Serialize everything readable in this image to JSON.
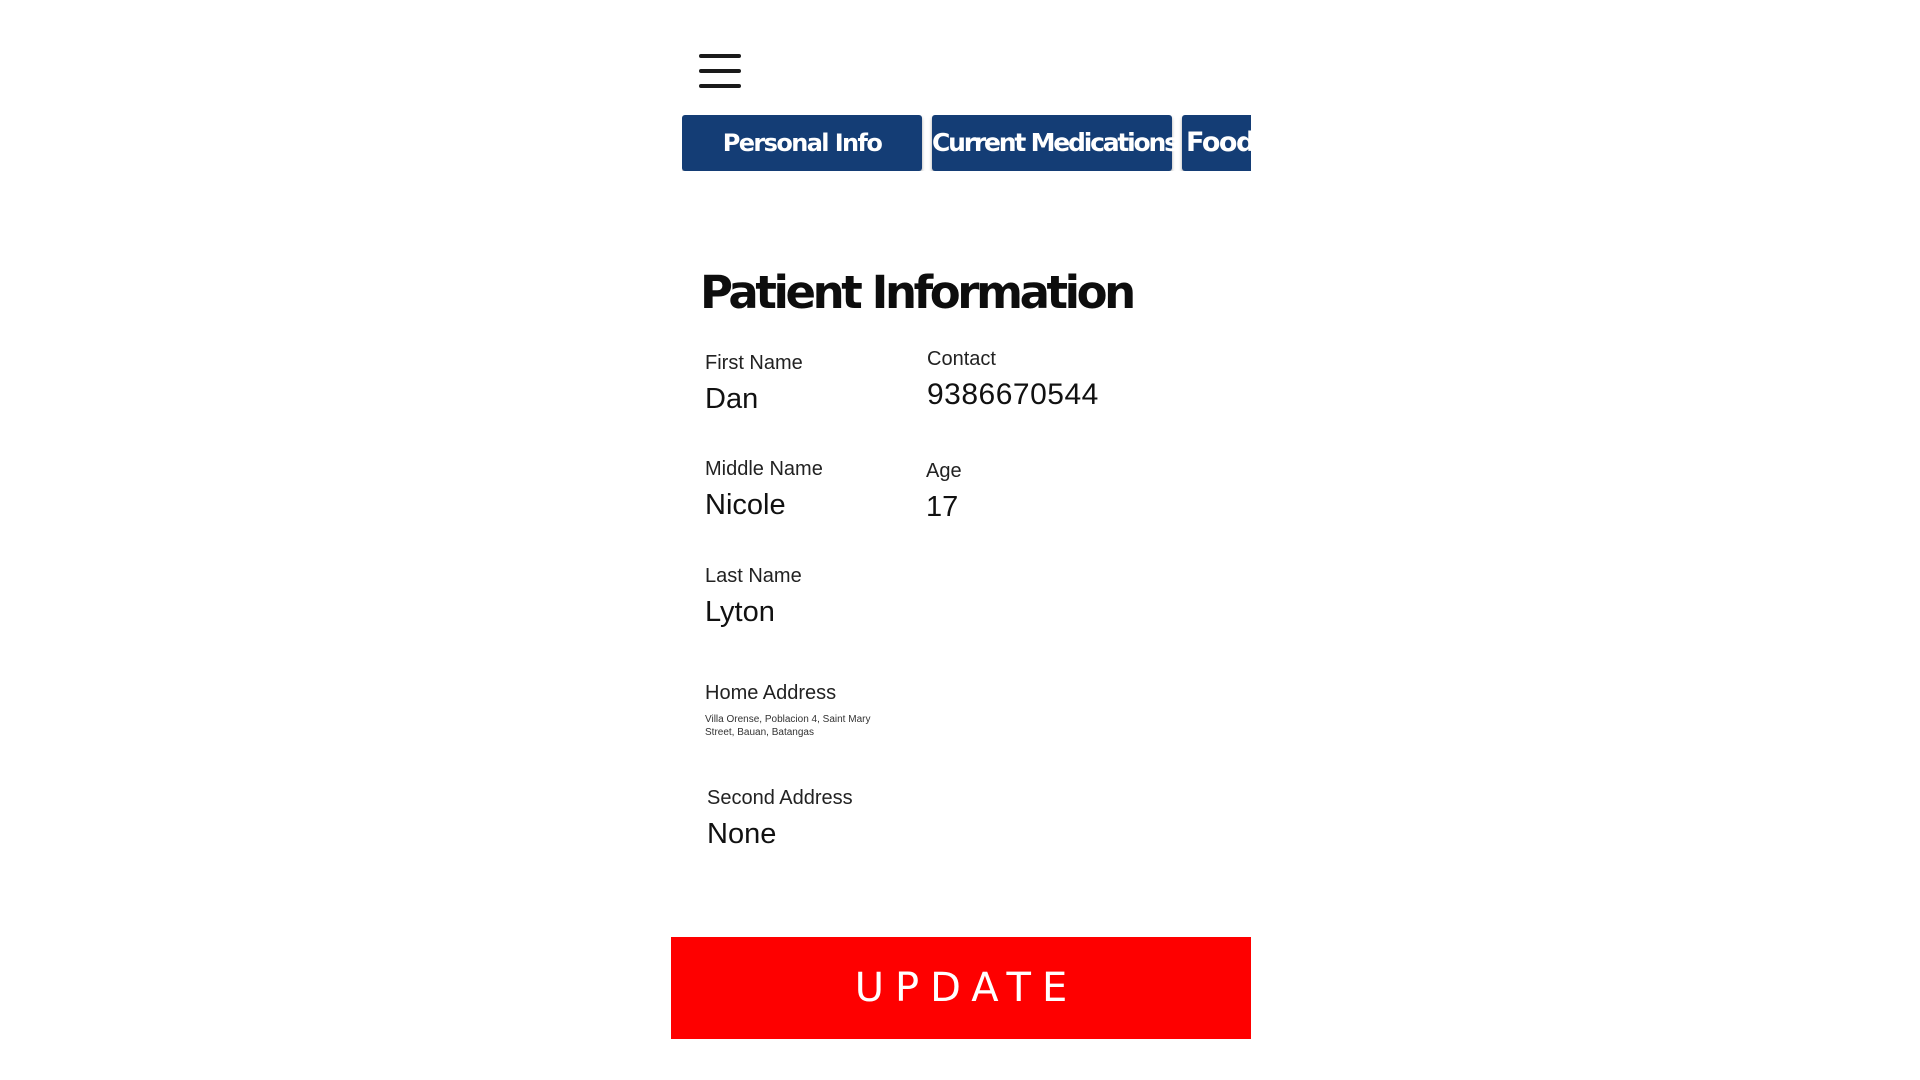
{
  "header": {
    "menu_icon": "hamburger-menu-icon"
  },
  "tabs": [
    {
      "label": "Personal Info"
    },
    {
      "label": "Current Medications"
    },
    {
      "label": "Food"
    }
  ],
  "main": {
    "title": "Patient Information",
    "fields": {
      "first_name": {
        "label": "First Name",
        "value": "Dan"
      },
      "contact": {
        "label": "Contact",
        "value": "9386670544"
      },
      "middle_name": {
        "label": "Middle Name",
        "value": "Nicole"
      },
      "age": {
        "label": "Age",
        "value": "17"
      },
      "last_name": {
        "label": "Last Name",
        "value": "Lyton"
      },
      "home_address": {
        "label": "Home Address",
        "value": "Villa Orense, Poblacion 4, Saint Mary Street, Bauan, Batangas"
      },
      "second_address": {
        "label": "Second Address",
        "value": "None"
      }
    }
  },
  "actions": {
    "update_label": "UPDATE"
  },
  "colors": {
    "tab_background": "#143d75",
    "tab_text": "#ffffff",
    "update_background": "#fe0000",
    "update_text": "#ffffff"
  }
}
